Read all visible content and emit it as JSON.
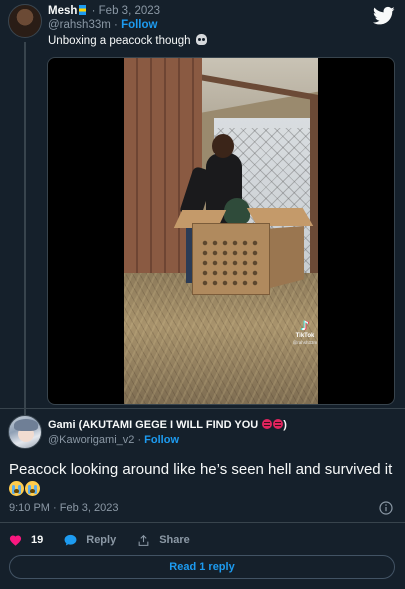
{
  "original_tweet": {
    "display_name": "Mesh",
    "timestamp": "Feb 3, 2023",
    "handle": "@rahsh33m",
    "follow_label": "Follow",
    "text": "Unboxing a peacock though",
    "text_emoji": "skull",
    "media": {
      "watermark_logo": "♪",
      "watermark_label": "TikTok",
      "watermark_handle": "@rahsh33m"
    }
  },
  "reply": {
    "display_name": "Gami (AKUTAMI GEGE I WILL FIND YOU",
    "name_emoji": [
      "angry-face",
      "angry-face"
    ],
    "display_name_close": ")",
    "handle": "@Kaworigami_v2",
    "follow_label": "Follow",
    "text": "Peacock looking around like he’s seen hell and survived it",
    "text_emoji": [
      "loudly-crying-face",
      "loudly-crying-face"
    ],
    "time": "9:10 PM",
    "date": "Feb 3, 2023",
    "likes": "19",
    "reply_label": "Reply",
    "share_label": "Share"
  },
  "read_replies_label": "Read 1 reply",
  "colors": {
    "background": "#15202b",
    "accent": "#1d9bf0",
    "like": "#f91880",
    "muted": "#8b98a5",
    "border": "#38444d"
  },
  "icons": [
    "twitter-bird-icon",
    "heart-icon",
    "reply-icon",
    "share-icon",
    "info-icon"
  ]
}
